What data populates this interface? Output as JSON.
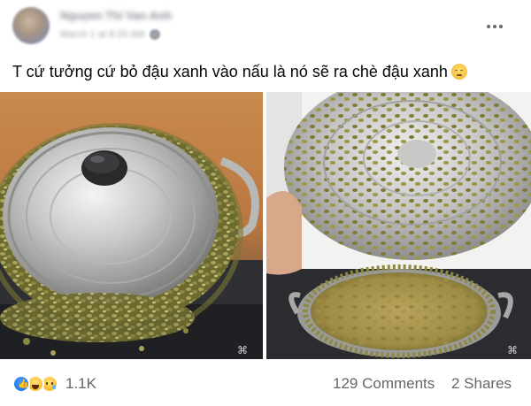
{
  "post": {
    "author_name": "Nguyen Thi Van Anh",
    "time": "March 1 at 8:20 AM",
    "caption": "T cứ tưởng cứ bỏ đậu xanh vào nấu là nó sẽ ra chè đậu xanh",
    "caption_emoji": "pensive-face-emoji"
  },
  "icons": {
    "more": "more-options-icon",
    "privacy": "globe-icon",
    "reactions": [
      "like-reaction-icon",
      "haha-reaction-icon",
      "sad-reaction-icon"
    ]
  },
  "footer": {
    "reaction_count": "1.1K",
    "comments": "129 Comments",
    "shares": "2 Shares"
  },
  "colors": {
    "text_primary": "#050505",
    "text_secondary": "#65676b",
    "like_blue": "#1877f2",
    "reaction_yellow": "#f7b125"
  }
}
